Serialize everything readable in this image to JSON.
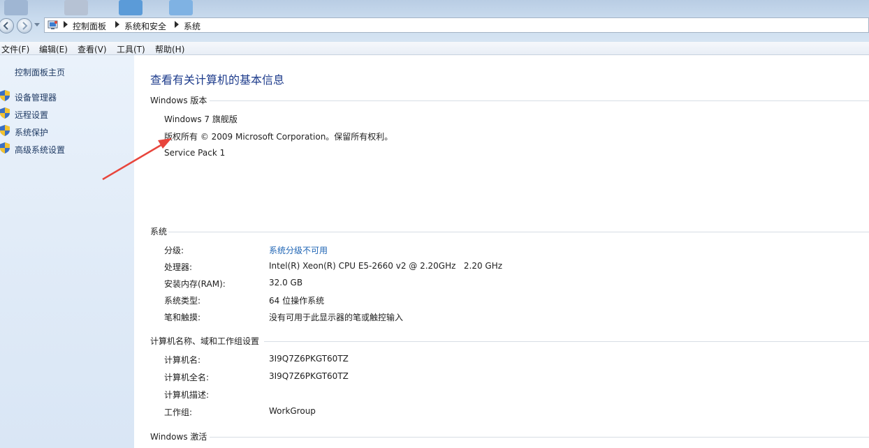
{
  "breadcrumb": {
    "items": [
      "控制面板",
      "系统和安全",
      "系统"
    ]
  },
  "icons": {
    "back": "back-arrow-icon",
    "forward": "forward-arrow-icon",
    "control_panel": "control-panel-icon",
    "shield": "uac-shield-icon"
  },
  "colors": {
    "title": "#1e3c8c",
    "link": "#1e64b4",
    "sidebar_text": "#1f3a63",
    "annotation_arrow": "#e8453c"
  },
  "menu": {
    "items": [
      "文件(F)",
      "编辑(E)",
      "查看(V)",
      "工具(T)",
      "帮助(H)"
    ]
  },
  "sidebar": {
    "home": "控制面板主页",
    "links": [
      "设备管理器",
      "远程设置",
      "系统保护",
      "高级系统设置"
    ]
  },
  "main": {
    "title": "查看有关计算机的基本信息",
    "windows_edition": {
      "heading": "Windows 版本",
      "edition": "Windows 7 旗舰版",
      "copyright": "版权所有 © 2009 Microsoft Corporation。保留所有权利。",
      "service_pack": "Service Pack 1"
    },
    "system": {
      "heading": "系统",
      "rating_label": "分级:",
      "rating_value": "系统分级不可用",
      "processor_label": "处理器:",
      "processor_value": "Intel(R) Xeon(R) CPU E5-2660 v2 @ 2.20GHz   2.20 GHz",
      "ram_label": "安装内存(RAM):",
      "ram_value": "32.0 GB",
      "type_label": "系统类型:",
      "type_value": "64 位操作系统",
      "pen_label": "笔和触摸:",
      "pen_value": "没有可用于此显示器的笔或触控输入"
    },
    "computer_name": {
      "heading": "计算机名称、域和工作组设置",
      "name_label": "计算机名:",
      "name_value": "3I9Q7Z6PKGT60TZ",
      "fullname_label": "计算机全名:",
      "fullname_value": "3I9Q7Z6PKGT60TZ",
      "desc_label": "计算机描述:",
      "desc_value": "",
      "workgroup_label": "工作组:",
      "workgroup_value": "WorkGroup"
    },
    "activation": {
      "heading": "Windows 激活"
    }
  }
}
